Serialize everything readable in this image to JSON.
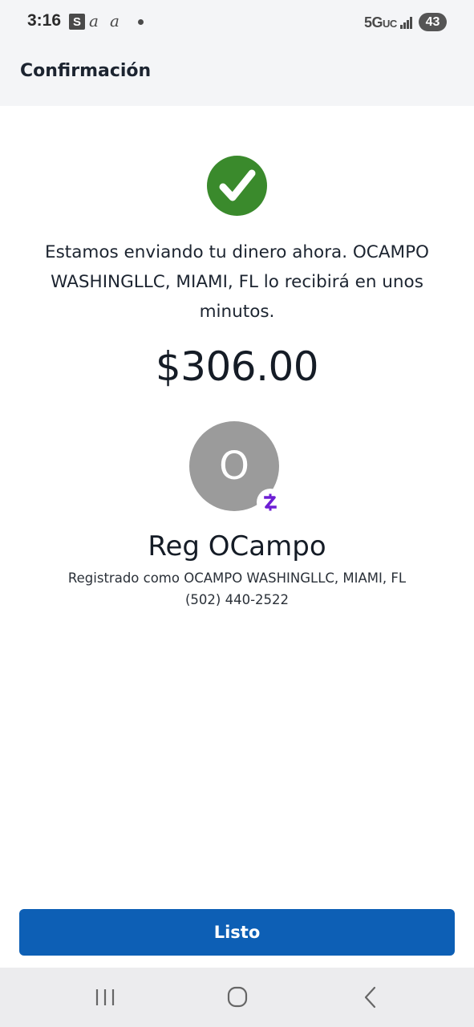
{
  "status_bar": {
    "time": "3:16",
    "s_badge": "S",
    "script_a1": "a",
    "script_a2": "a",
    "network": "5G",
    "network_suffix": "UC",
    "battery": "43"
  },
  "header": {
    "title": "Confirmación"
  },
  "confirmation": {
    "icon": "checkmark-icon",
    "message": "Estamos enviando tu dinero ahora. OCAMPO WASHINGLLC, MIAMI, FL lo recibirá en unos minutos.",
    "amount": "$306.00"
  },
  "recipient": {
    "initial": "O",
    "name": "Reg OCampo",
    "registered_as": "Registrado como OCAMPO WASHINGLLC, MIAMI, FL",
    "phone": "(502) 440-2522",
    "badge_icon": "zelle-icon"
  },
  "actions": {
    "done_label": "Listo"
  },
  "nav": {
    "recents_icon": "recents-icon",
    "home_icon": "home-icon",
    "back_icon": "back-icon"
  },
  "colors": {
    "success_green": "#3a8a2c",
    "primary_blue": "#0d5fb5",
    "zelle_purple": "#6d1ed4",
    "avatar_gray": "#9b9b9b"
  }
}
